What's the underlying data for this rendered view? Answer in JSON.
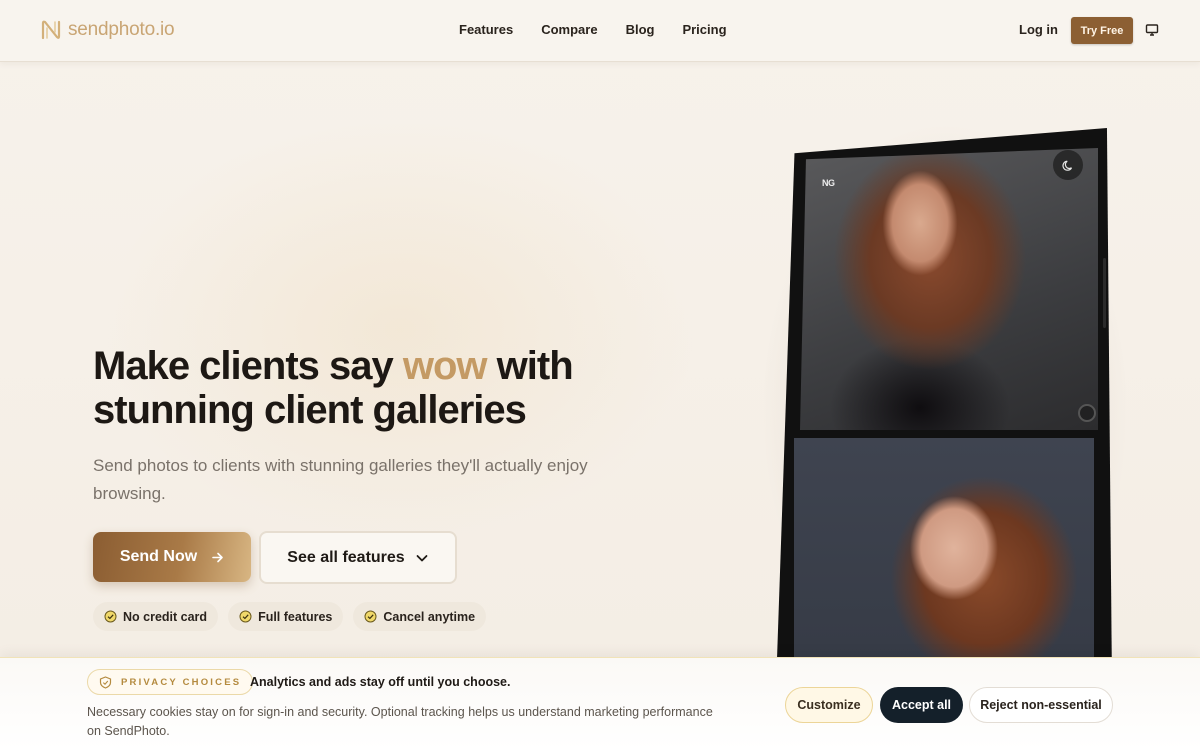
{
  "brand": {
    "name": "sendphoto.io",
    "accent_color": "#c49a64",
    "button_color": "#8c5f33"
  },
  "nav": {
    "links": [
      "Features",
      "Compare",
      "Blog",
      "Pricing"
    ],
    "login": "Log in",
    "try_free": "Try Free",
    "theme_icon": "monitor-icon"
  },
  "hero": {
    "headline_part1": "Make clients say ",
    "headline_accent": "wow",
    "headline_part2": " with stunning client galleries",
    "subtitle": "Send photos to clients with stunning galleries they'll actually enjoy browsing.",
    "primary_button": "Send Now",
    "secondary_button": "See all features",
    "pills": [
      "No credit card",
      "Full features",
      "Cancel anytime"
    ]
  },
  "device": {
    "watermark": "NG",
    "moon_icon": "moon-icon"
  },
  "cookie": {
    "chip_label": "PRIVACY CHOICES",
    "title": "Analytics and ads stay off until you choose.",
    "text": "Necessary cookies stay on for sign-in and security. Optional tracking helps us understand marketing performance on SendPhoto.",
    "customize": "Customize",
    "accept": "Accept all",
    "reject": "Reject non-essential"
  }
}
